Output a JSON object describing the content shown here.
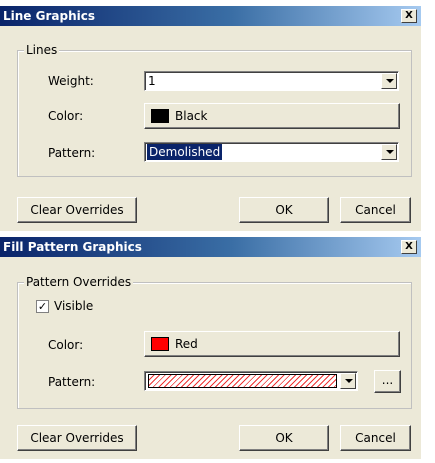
{
  "line_dialog": {
    "title": "Line Graphics",
    "close_symbol": "X",
    "group_label": "Lines",
    "weight_label": "Weight:",
    "weight_value": "1",
    "color_label": "Color:",
    "color_name": "Black",
    "color_hex": "#000000",
    "pattern_label": "Pattern:",
    "pattern_value": "Demolished",
    "clear_label": "Clear Overrides",
    "ok_label": "OK",
    "cancel_label": "Cancel"
  },
  "fill_dialog": {
    "title": "Fill Pattern Graphics",
    "close_symbol": "X",
    "group_label": "Pattern Overrides",
    "visible_label": "Visible",
    "visible_checked": "✓",
    "color_label": "Color:",
    "color_name": "Red",
    "color_hex": "#ff0000",
    "pattern_label": "Pattern:",
    "pattern_icon": "diagonal-hatch-pattern",
    "ellipsis_label": "...",
    "clear_label": "Clear Overrides",
    "ok_label": "OK",
    "cancel_label": "Cancel"
  }
}
